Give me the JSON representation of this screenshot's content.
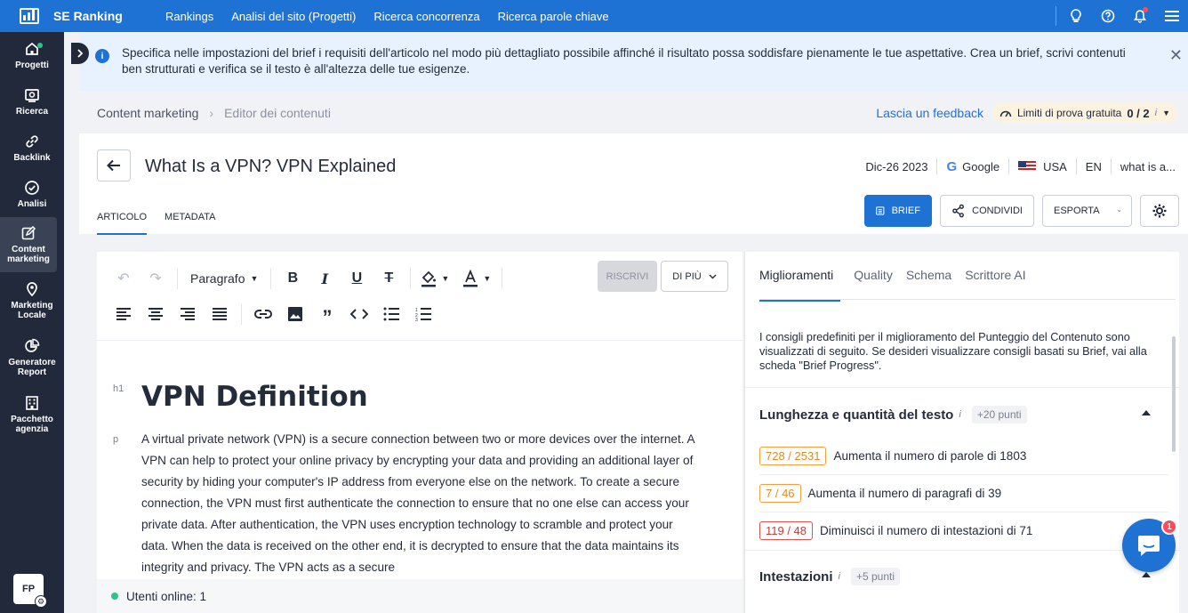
{
  "app": {
    "name": "SE Ranking",
    "nav": [
      "Rankings",
      "Analisi del sito (Progetti)",
      "Ricerca concorrenza",
      "Ricerca parole chiave"
    ]
  },
  "topbar_icons": [
    "lightbulb-icon",
    "help-icon",
    "bell-icon",
    "menu-icon"
  ],
  "sidebar": {
    "items": [
      {
        "label": "Progetti",
        "icon": "home-icon"
      },
      {
        "label": "Ricerca",
        "icon": "search-icon"
      },
      {
        "label": "Backlink",
        "icon": "link-icon"
      },
      {
        "label": "Analisi",
        "icon": "check-circle-icon"
      },
      {
        "label": "Content marketing",
        "icon": "edit-icon"
      },
      {
        "label": "Marketing Locale",
        "icon": "pin-icon"
      },
      {
        "label": "Generatore Report",
        "icon": "pie-chart-icon"
      },
      {
        "label": "Pacchetto agenzia",
        "icon": "building-icon"
      }
    ],
    "avatar": "FP"
  },
  "banner": {
    "text": "Specifica nelle impostazioni del brief i requisiti dell'articolo nel modo più dettagliato possibile affinché il risultato possa soddisfare pienamente le tue aspettative. Crea un brief, scrivi contenuti ben strutturati e verifica se il testo è all'altezza delle tue esigenze."
  },
  "breadcrumb": {
    "parent": "Content marketing",
    "current": "Editor dei contenuti",
    "feedback": "Lascia un feedback",
    "limits_label": "Limiti di prova gratuita",
    "limits_value": "0 / 2",
    "limits_info": "i"
  },
  "document": {
    "title": "What Is a VPN? VPN Explained",
    "date": "Dic-26 2023",
    "engine": "Google",
    "country": "USA",
    "language": "EN",
    "keyword": "what is a...",
    "tabs": [
      "ARTICOLO",
      "METADATA"
    ]
  },
  "actions": {
    "brief": "BRIEF",
    "share": "CONDIVIDI",
    "export": "ESPORTA"
  },
  "editor": {
    "paragraph_select": "Paragrafo",
    "rewrite": "RISCRIVI",
    "more": "DI PIÙ",
    "h1_tag": "h1",
    "p_tag": "p",
    "heading": "VPN Definition",
    "body": "A virtual private network (VPN) is a secure connection between two or more devices over the internet. A VPN can help to protect your online privacy by encrypting your data and providing an additional layer of security by hiding your computer's IP address from everyone else on the network. To create a secure connection, the VPN must first authenticate the connection to ensure that no one else can access your private data. After authentication, the VPN uses encryption technology to scramble and protect your data. When the data is received on the other end, it is decrypted to ensure that the data maintains its integrity and privacy. The VPN acts as a secure",
    "online_users": "Utenti online: 1"
  },
  "panel": {
    "tabs": [
      "Miglioramenti",
      "Quality",
      "Schema",
      "Scrittore AI"
    ],
    "description": "I consigli predefiniti per il miglioramento del Punteggio del Contenuto sono visualizzati di seguito. Se desideri visualizzare consigli basati su Brief, vai alla scheda \"Brief Progress\".",
    "section1": {
      "title": "Lunghezza e quantità del testo",
      "info": "i",
      "points": "+20 punti",
      "rows": [
        {
          "badge": "728 / 2531",
          "text": "Aumenta il numero di parole di 1803",
          "status": "orange"
        },
        {
          "badge": "7 / 46",
          "text": "Aumenta il numero di paragrafi di 39",
          "status": "orange"
        },
        {
          "badge": "119 / 48",
          "text": "Diminuisci il numero di intestazioni di 71",
          "status": "red"
        }
      ]
    },
    "section2": {
      "title": "Intestazioni",
      "info": "i",
      "points": "+5 punti"
    }
  },
  "chat": {
    "badge": "1"
  },
  "colors": {
    "brand": "#1e72d4",
    "sidebar": "#22293a",
    "warning": "#e08a1e",
    "danger": "#c73c38"
  }
}
